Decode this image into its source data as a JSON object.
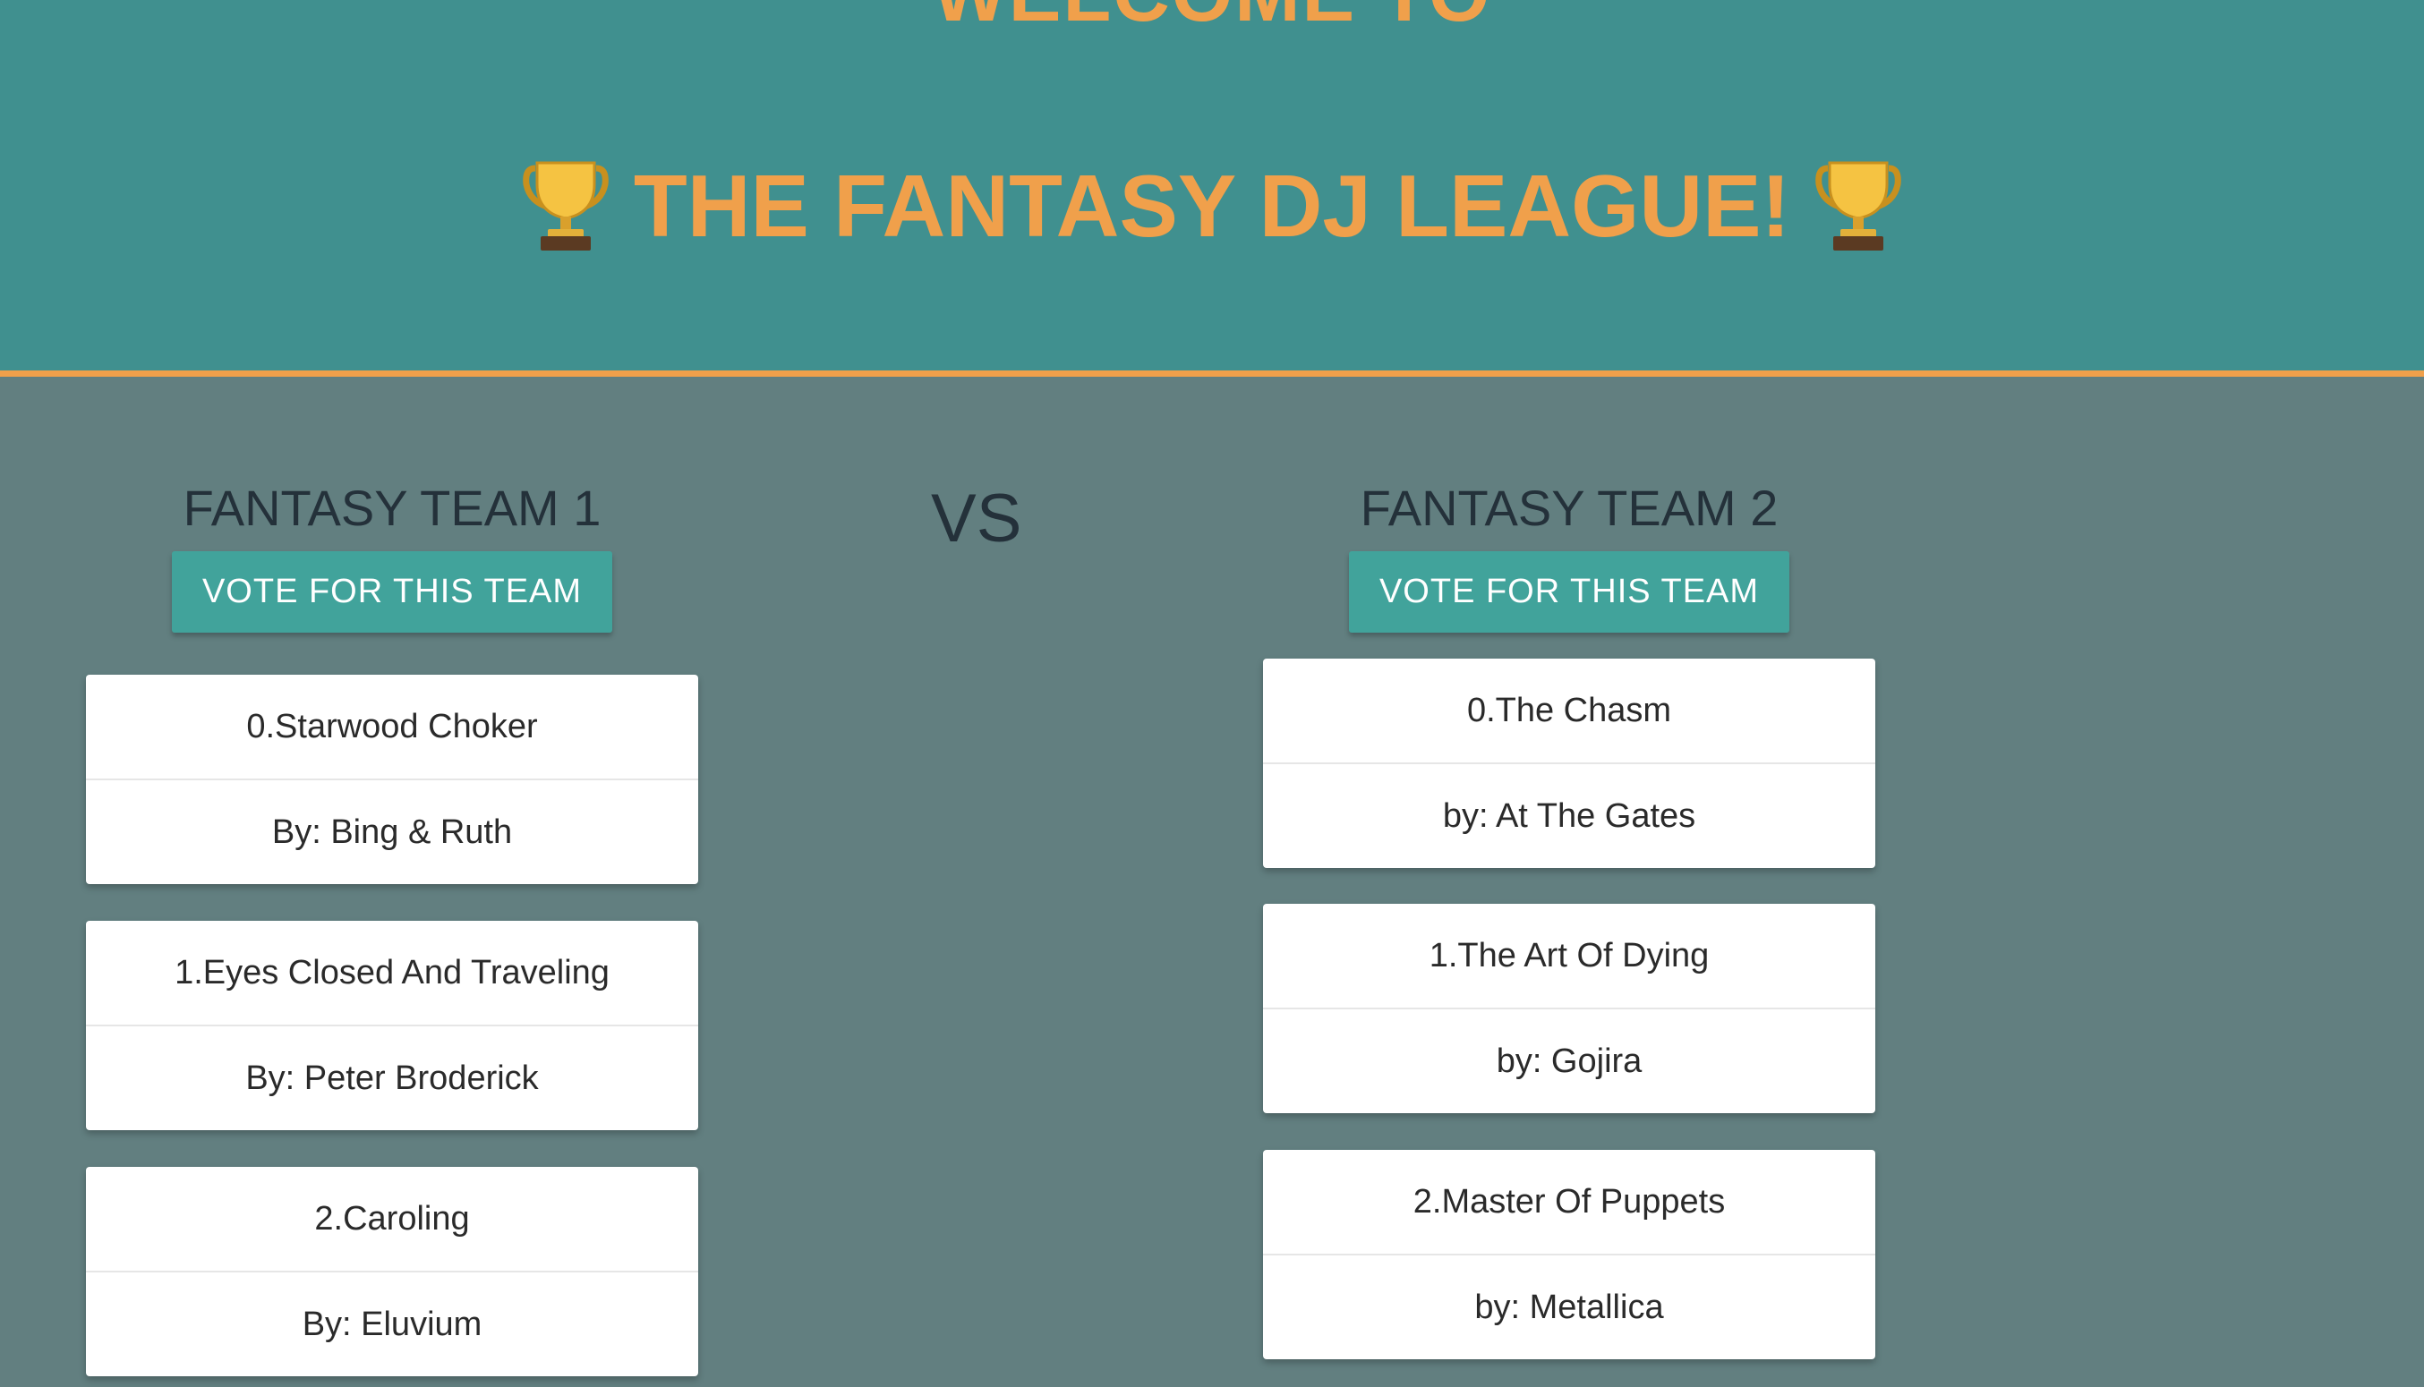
{
  "header": {
    "welcome": "WELCOME TO",
    "title": "THE FANTASY DJ LEAGUE!",
    "icon_left": "trophy-icon",
    "icon_right": "trophy-icon"
  },
  "vs_label": "VS",
  "team1": {
    "title": "FANTASY TEAM 1",
    "vote_label": "VOTE FOR THIS TEAM",
    "songs": [
      {
        "name": "0.Starwood Choker",
        "artist": "By: Bing & Ruth"
      },
      {
        "name": "1.Eyes Closed And Traveling",
        "artist": "By: Peter Broderick"
      },
      {
        "name": "2.Caroling",
        "artist": "By: Eluvium"
      }
    ]
  },
  "team2": {
    "title": "FANTASY TEAM 2",
    "vote_label": "VOTE FOR THIS TEAM",
    "songs": [
      {
        "name": "0.The Chasm",
        "artist": "by: At The Gates"
      },
      {
        "name": "1.The Art Of Dying",
        "artist": "by: Gojira"
      },
      {
        "name": "2.Master Of Puppets",
        "artist": "by: Metallica"
      }
    ]
  },
  "colors": {
    "header_bg": "#40908f",
    "accent": "#f0a04b",
    "page_bg": "#627f80",
    "button_bg": "#41a39b"
  }
}
